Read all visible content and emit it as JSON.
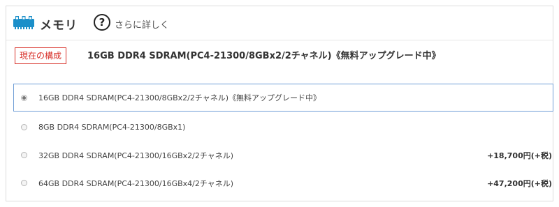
{
  "section": {
    "title": "メモリ",
    "help_link": "さらに詳しく",
    "help_icon_text": "?"
  },
  "current": {
    "badge": "現在の構成",
    "text": "16GB DDR4 SDRAM(PC4-21300/8GBx2/2チャネル)《無料アップグレード中》"
  },
  "options": [
    {
      "label": "16GB DDR4 SDRAM(PC4-21300/8GBx2/2チャネル)《無料アップグレード中》",
      "price": "",
      "selected": true
    },
    {
      "label": "8GB DDR4 SDRAM(PC4-21300/8GBx1)",
      "price": "",
      "selected": false
    },
    {
      "label": "32GB DDR4 SDRAM(PC4-21300/16GBx2/2チャネル)",
      "price": "+18,700円(+税)",
      "selected": false
    },
    {
      "label": "64GB DDR4 SDRAM(PC4-21300/16GBx4/2チャネル)",
      "price": "+47,200円(+税)",
      "selected": false
    }
  ],
  "colors": {
    "accent_red": "#d8312a",
    "selected_border": "#6f9ed6",
    "memory_icon": "#1b8fc9"
  }
}
